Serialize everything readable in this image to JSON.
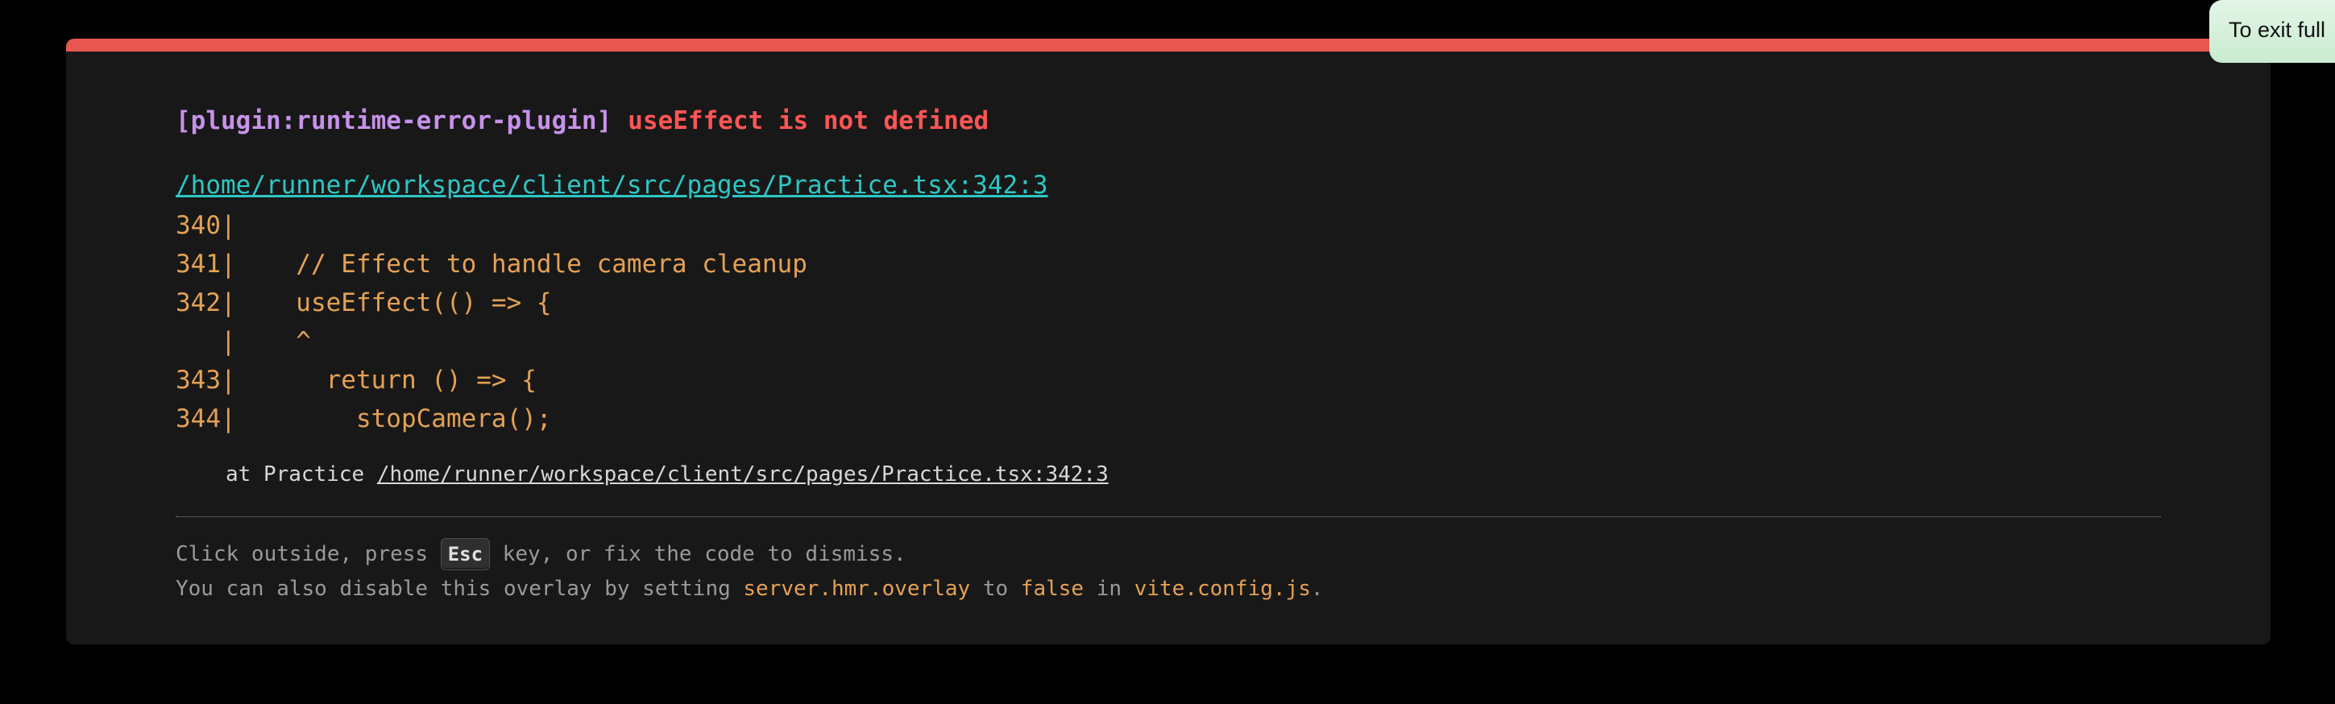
{
  "error": {
    "plugin": "[plugin:runtime-error-plugin]",
    "message": "useEffect is not defined",
    "file": "/home/runner/workspace/client/src/pages/Practice.tsx:342:3",
    "frame": "340|\n341|    // Effect to handle camera cleanup\n342|    useEffect(() => {\n   |    ^\n343|      return () => {\n344|        stopCamera();",
    "stack_prefix": "at Practice ",
    "stack_link": "/home/runner/workspace/client/src/pages/Practice.tsx:342:3"
  },
  "tip": {
    "line1_before": "Click outside, press ",
    "key": "Esc",
    "line1_after": " key, or fix the code to dismiss.",
    "line2_before": "You can also disable this overlay by setting ",
    "setting": "server.hmr.overlay",
    "line2_mid": " to ",
    "value": "false",
    "line2_in": " in ",
    "config_file": "vite.config.js",
    "line2_end": "."
  },
  "toast": {
    "text": "To exit full"
  },
  "colors": {
    "accent_bar": "#e8574f",
    "plugin": "#c792ea",
    "message": "#ff5555",
    "file_link": "#2dc7c4",
    "code": "#e5a155",
    "background": "#181818"
  }
}
